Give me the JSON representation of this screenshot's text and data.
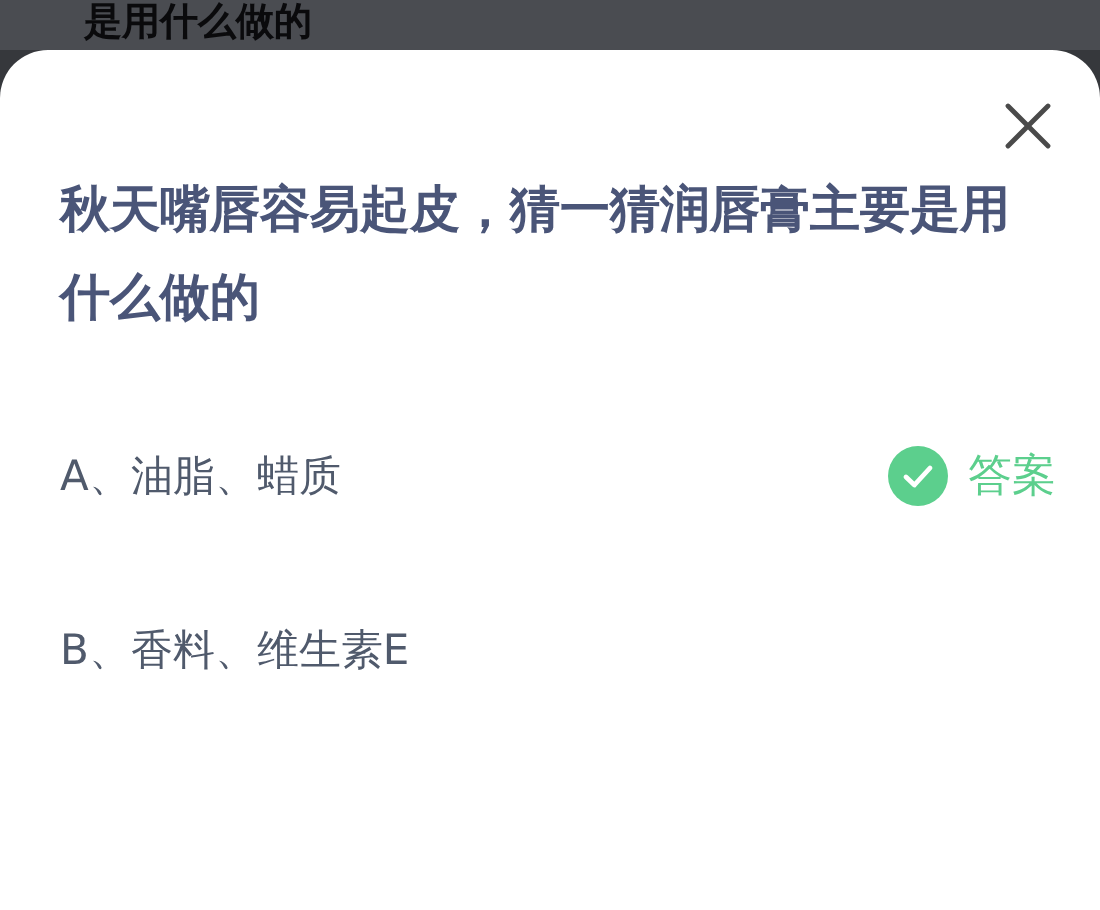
{
  "background_text": "是用什么做的",
  "question": "秋天嘴唇容易起皮，猜一猜润唇膏主要是用什么做的",
  "options": [
    {
      "label": "A、油脂、蜡质",
      "correct": true,
      "answer_label": "答案"
    },
    {
      "label": "B、香料、维生素E",
      "correct": false
    }
  ]
}
